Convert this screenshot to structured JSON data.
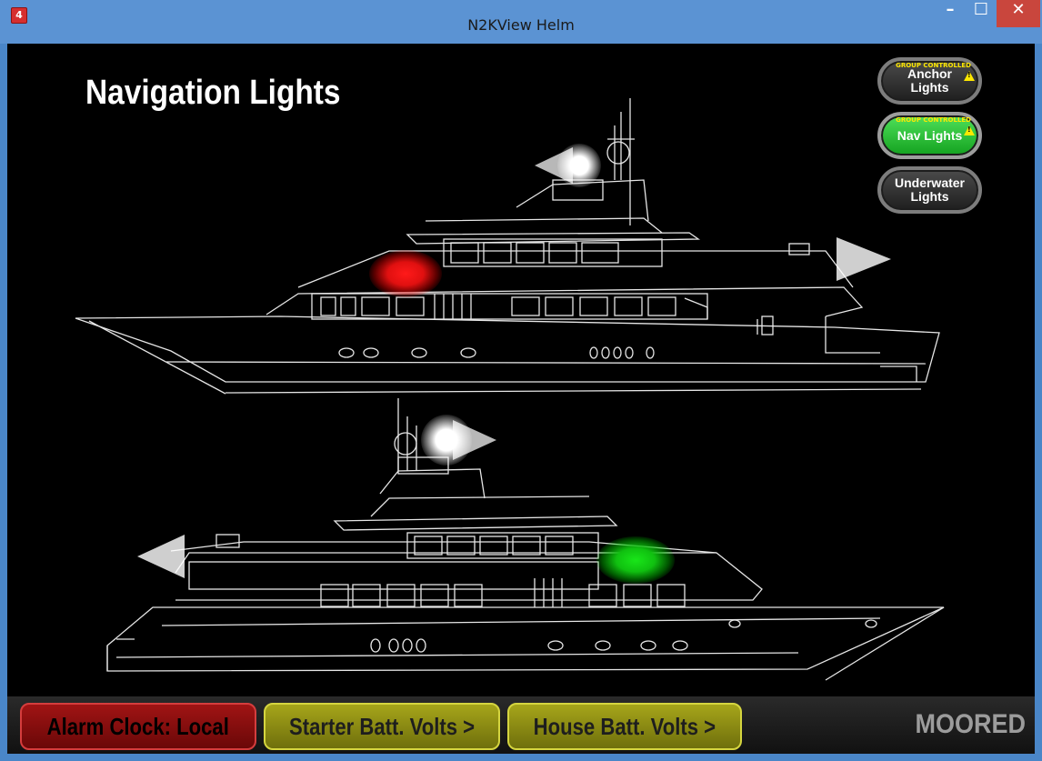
{
  "window": {
    "title": "N2KView Helm",
    "app_icon": "n2kview-app-icon",
    "minimize_symbol": "–",
    "maximize_symbol": "☐",
    "close_symbol": "✕"
  },
  "page": {
    "heading": "Navigation Lights"
  },
  "controls": [
    {
      "label_line1": "Anchor",
      "label_line2": "Lights",
      "tag": "GROUP CONTROLLED",
      "warning": true,
      "active": false
    },
    {
      "label_line1": "Nav Lights",
      "label_line2": "",
      "tag": "GROUP CONTROLLED",
      "warning": true,
      "active": true
    },
    {
      "label_line1": "Underwater",
      "label_line2": "Lights",
      "tag": "",
      "warning": false,
      "active": false
    }
  ],
  "lights": {
    "port_color": "#ff1a1a",
    "starboard_color": "#19e619",
    "white_color": "#ffffff"
  },
  "bottom_bar": {
    "alarm_label": "Alarm Clock: Local",
    "starter_label": "Starter Batt. Volts >",
    "house_label": "House Batt. Volts >",
    "status": "MOORED",
    "alarm_color": "#8b1010",
    "battery_color": "#a6a51a"
  }
}
